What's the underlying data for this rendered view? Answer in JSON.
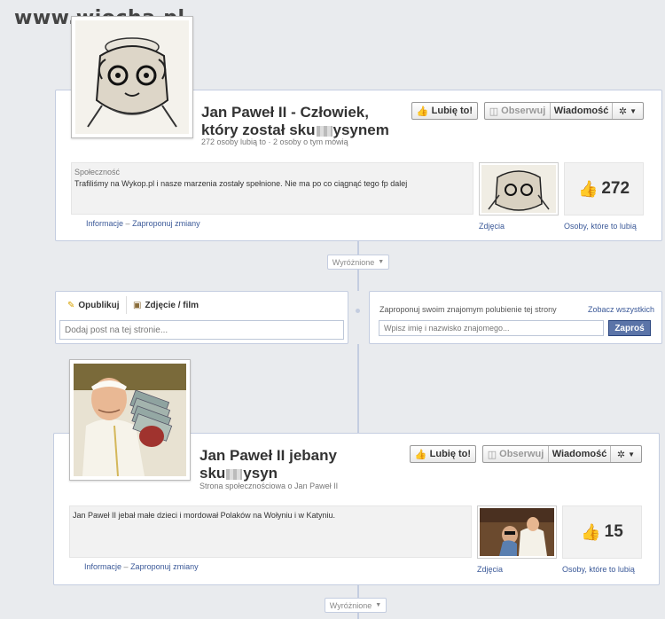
{
  "watermark": "www.wiocha.pl",
  "page1": {
    "title_line1": "Jan Paweł II - Człowiek,",
    "title_line2_a": "który został sku",
    "title_line2_b": "ysynem",
    "stats": "272 osoby lubią to · 2 osoby o tym mówią",
    "like_button": "Lubię to!",
    "follow_button": "Obserwuj",
    "message_button": "Wiadomość",
    "category": "Społeczność",
    "about": "Trafiliśmy na Wykop.pl i nasze marzenia zostały spełnione. Nie ma po co ciągnąć tego fp dalej",
    "info_link": "Informacje",
    "suggest_link": "Zaproponuj zmiany",
    "photos_label": "Zdjęcia",
    "likes_count": "272",
    "likes_label": "Osoby, które to lubią"
  },
  "highlight_pill_1": "Wyróżnione",
  "composer": {
    "publish_tab": "Opublikuj",
    "photo_tab": "Zdjęcie / film",
    "post_placeholder": "Dodaj post na tej stronie..."
  },
  "suggest": {
    "prompt": "Zaproponuj swoim znajomym polubienie tej strony",
    "see_all": "Zobacz wszystkich",
    "input_placeholder": "Wpisz imię i nazwisko znajomego...",
    "submit": "Zaproś"
  },
  "page2": {
    "title_line1": "Jan Paweł II jebany",
    "title_line2_a": "sku",
    "title_line2_b": "ysyn",
    "subtitle": "Strona społecznościowa o Jan Paweł II",
    "like_button": "Lubię to!",
    "follow_button": "Obserwuj",
    "message_button": "Wiadomość",
    "about": "Jan Paweł II jebał małe dzieci i mordował Polaków na Wołyniu i w Katyniu.",
    "info_link": "Informacje",
    "suggest_link": "Zaproponuj zmiany",
    "photos_label": "Zdjęcia",
    "likes_count": "15",
    "likes_label": "Osoby, które to lubią"
  },
  "highlight_pill_2": "Wyróżnione",
  "colors": {
    "link": "#3b5998",
    "button_primary": "#5b74a8",
    "timeline": "#c4cde0"
  }
}
